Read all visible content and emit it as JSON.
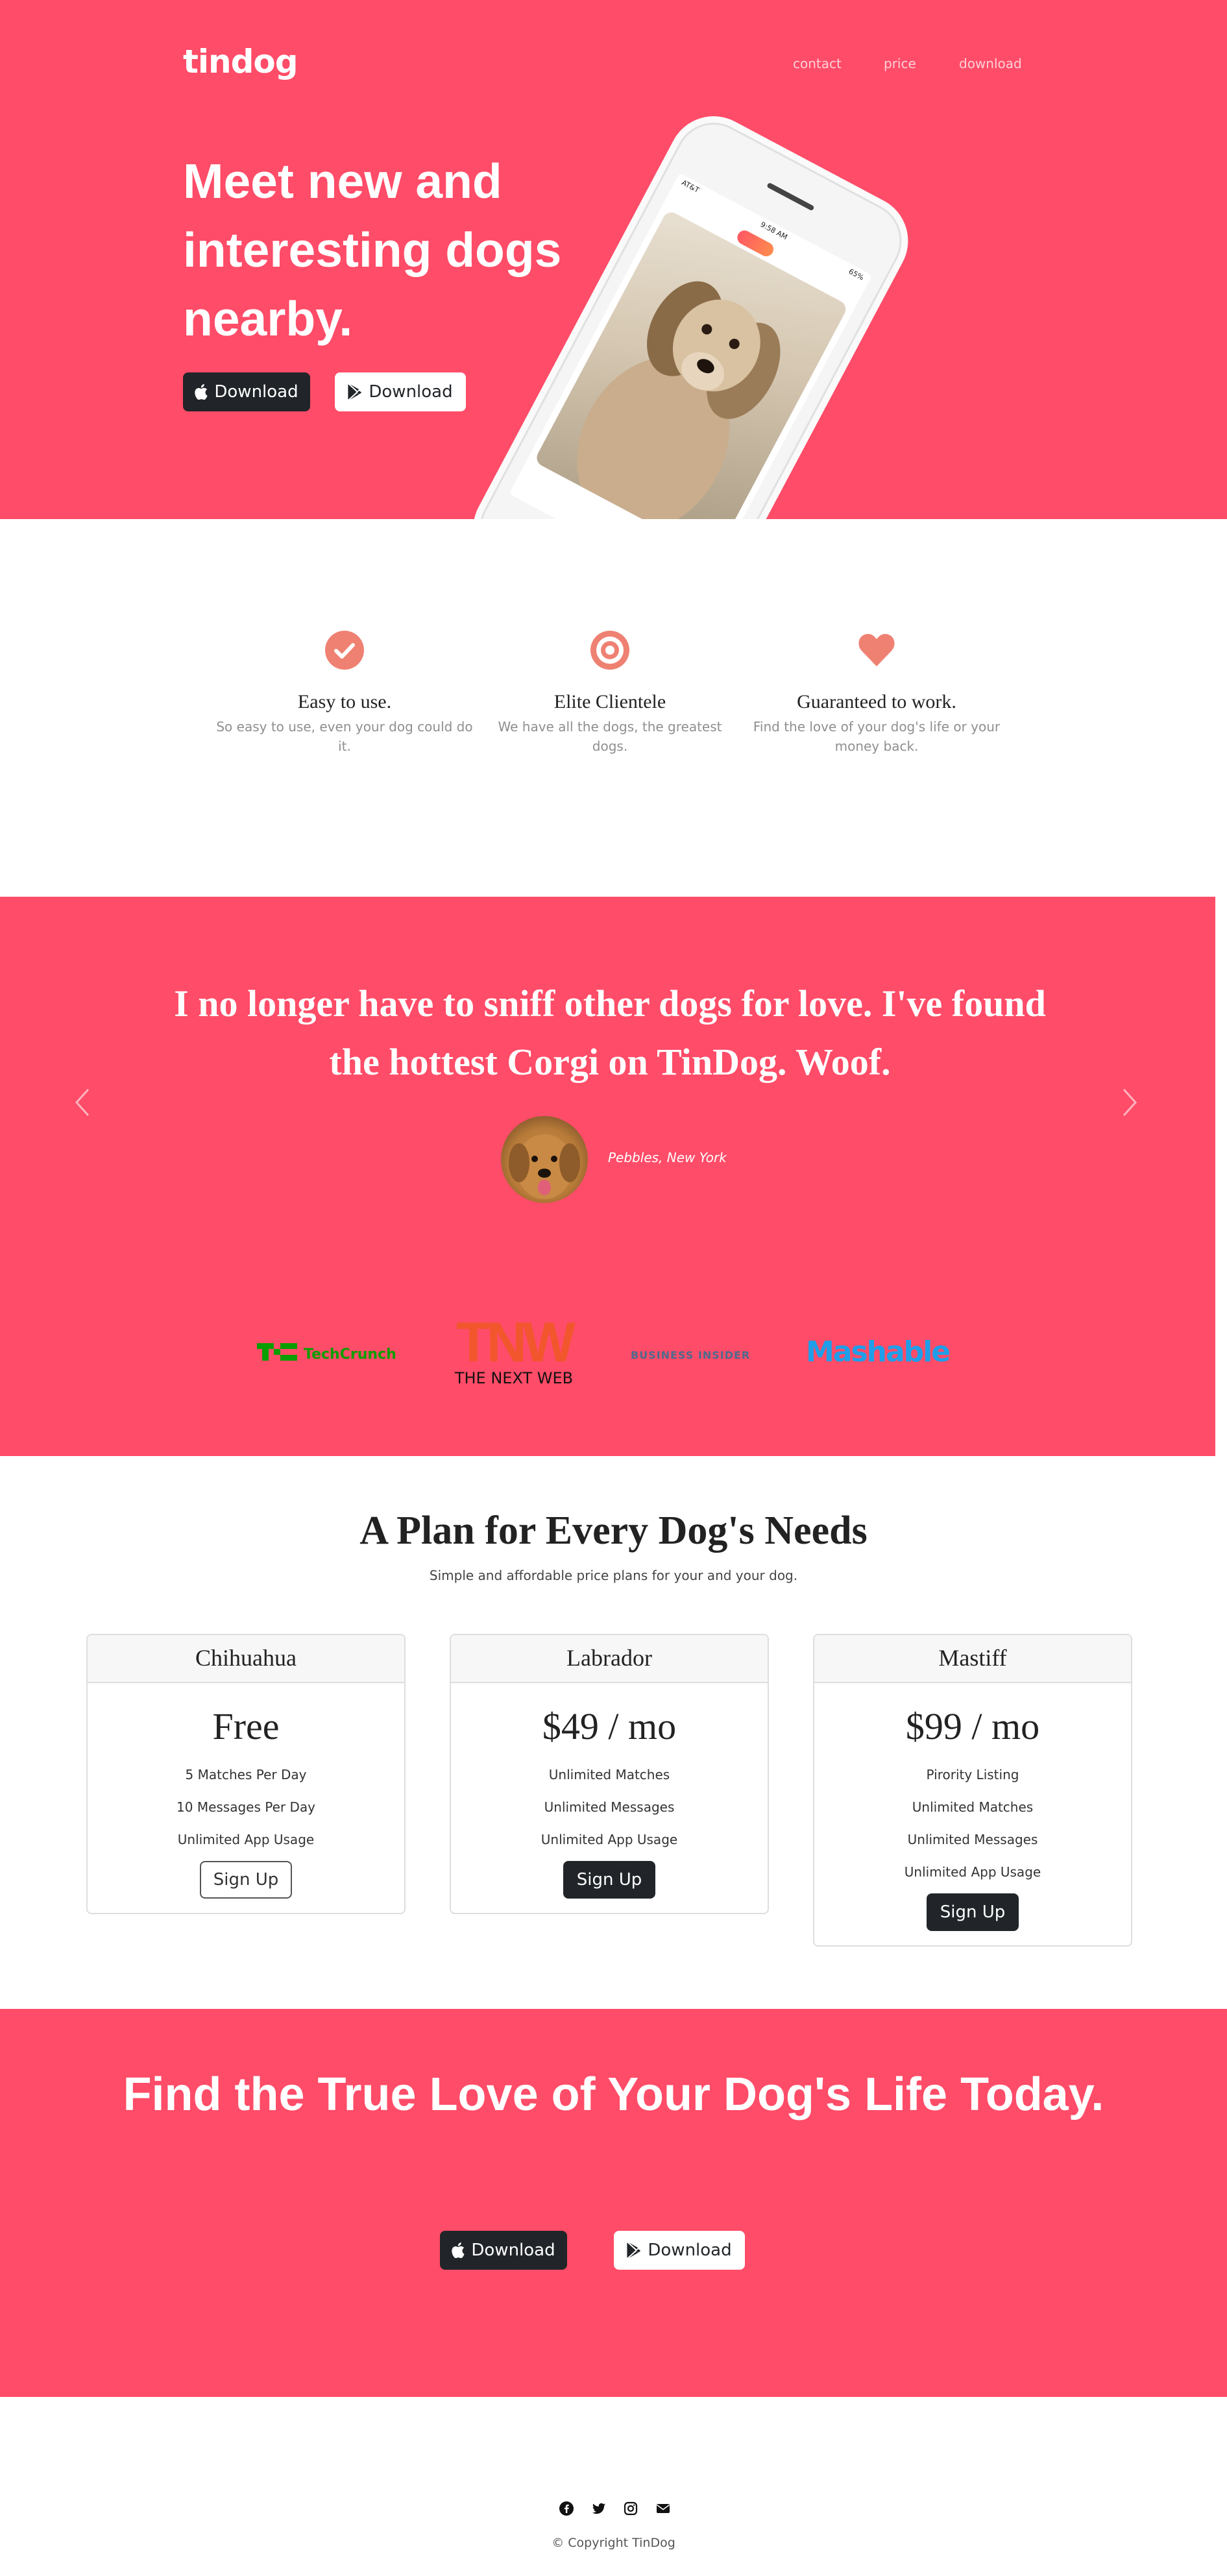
{
  "brand": "tindog",
  "nav": {
    "items": [
      "contact",
      "price",
      "download"
    ]
  },
  "hero": {
    "title": "Meet new and interesting dogs nearby.",
    "apple_button": "Download",
    "google_button": "Download",
    "phone": {
      "carrier": "AT&T",
      "time": "9:58 AM",
      "battery": "65%"
    }
  },
  "features": [
    {
      "icon": "check-circle-icon",
      "title": "Easy to use.",
      "text": "So easy to use, even your dog could do it."
    },
    {
      "icon": "bullseye-icon",
      "title": "Elite Clientele",
      "text": "We have all the dogs, the greatest dogs."
    },
    {
      "icon": "heart-icon",
      "title": "Guaranteed to work.",
      "text": "Find the love of your dog's life or your money back."
    }
  ],
  "testimonial": {
    "quote": "I no longer have to sniff other dogs for love. I've found the hottest Corgi on TinDog. Woof.",
    "author": "Pebbles, New York"
  },
  "press": {
    "techcrunch": "TechCrunch",
    "tnw_letters": "TNW",
    "tnw_name": "THE NEXT WEB",
    "business_insider": "BUSINESS INSIDER",
    "mashable": "Mashable"
  },
  "pricing": {
    "title": "A Plan for Every Dog's Needs",
    "subtitle": "Simple and affordable price plans for your and your dog.",
    "plans": [
      {
        "name": "Chihuahua",
        "price": "Free",
        "features": [
          "5 Matches Per Day",
          "10 Messages Per Day",
          "Unlimited App Usage"
        ],
        "button": "Sign Up"
      },
      {
        "name": "Labrador",
        "price": "$49 / mo",
        "features": [
          "Unlimited Matches",
          "Unlimited Messages",
          "Unlimited App Usage"
        ],
        "button": "Sign Up"
      },
      {
        "name": "Mastiff",
        "price": "$99 / mo",
        "features": [
          "Pirority Listing",
          "Unlimited Matches",
          "Unlimited Messages",
          "Unlimited App Usage"
        ],
        "button": "Sign Up"
      }
    ]
  },
  "cta": {
    "title": "Find the True Love of Your Dog's Life Today.",
    "apple_button": "Download",
    "google_button": "Download"
  },
  "footer": {
    "icons": [
      "facebook-icon",
      "twitter-icon",
      "instagram-icon",
      "envelope-icon"
    ],
    "copyright": "© Copyright TinDog"
  },
  "colors": {
    "accent": "#ff4c68",
    "dark": "#212529",
    "feature_icon": "#ef8172"
  }
}
